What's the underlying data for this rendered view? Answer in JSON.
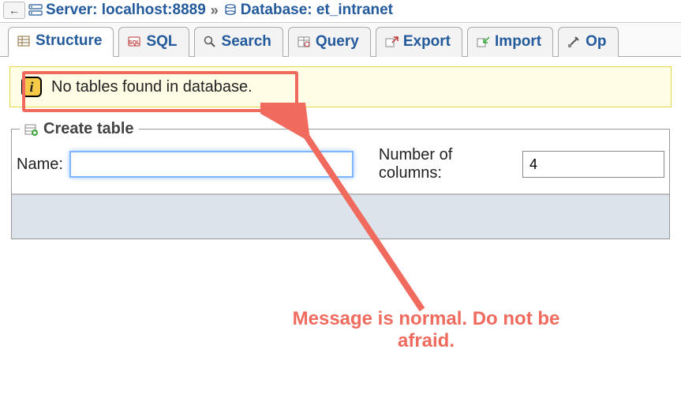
{
  "breadcrumb": {
    "server_label": "Server: localhost:8889",
    "database_label": "Database: et_intranet"
  },
  "tabs": [
    {
      "id": "structure",
      "label": "Structure",
      "active": true
    },
    {
      "id": "sql",
      "label": "SQL",
      "active": false
    },
    {
      "id": "search",
      "label": "Search",
      "active": false
    },
    {
      "id": "query",
      "label": "Query",
      "active": false
    },
    {
      "id": "export",
      "label": "Export",
      "active": false
    },
    {
      "id": "import",
      "label": "Import",
      "active": false
    },
    {
      "id": "operations",
      "label": "Op",
      "active": false
    }
  ],
  "notice": {
    "text": "No tables found in database."
  },
  "create": {
    "legend": "Create table",
    "name_label": "Name:",
    "name_value": "",
    "cols_label": "Number of columns:",
    "cols_value": "4"
  },
  "annotation": {
    "text": "Message is normal. Do not be afraid."
  }
}
